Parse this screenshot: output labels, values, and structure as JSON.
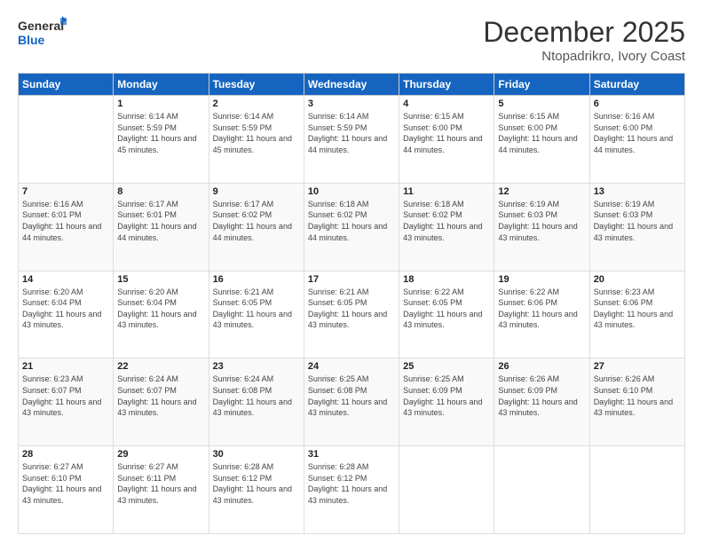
{
  "header": {
    "logo_line1": "General",
    "logo_line2": "Blue",
    "title": "December 2025",
    "subtitle": "Ntopadrikro, Ivory Coast"
  },
  "days_of_week": [
    "Sunday",
    "Monday",
    "Tuesday",
    "Wednesday",
    "Thursday",
    "Friday",
    "Saturday"
  ],
  "weeks": [
    [
      {
        "day": "",
        "info": ""
      },
      {
        "day": "1",
        "info": "Sunrise: 6:14 AM\nSunset: 5:59 PM\nDaylight: 11 hours and 45 minutes."
      },
      {
        "day": "2",
        "info": "Sunrise: 6:14 AM\nSunset: 5:59 PM\nDaylight: 11 hours and 45 minutes."
      },
      {
        "day": "3",
        "info": "Sunrise: 6:14 AM\nSunset: 5:59 PM\nDaylight: 11 hours and 44 minutes."
      },
      {
        "day": "4",
        "info": "Sunrise: 6:15 AM\nSunset: 6:00 PM\nDaylight: 11 hours and 44 minutes."
      },
      {
        "day": "5",
        "info": "Sunrise: 6:15 AM\nSunset: 6:00 PM\nDaylight: 11 hours and 44 minutes."
      },
      {
        "day": "6",
        "info": "Sunrise: 6:16 AM\nSunset: 6:00 PM\nDaylight: 11 hours and 44 minutes."
      }
    ],
    [
      {
        "day": "7",
        "info": "Sunrise: 6:16 AM\nSunset: 6:01 PM\nDaylight: 11 hours and 44 minutes."
      },
      {
        "day": "8",
        "info": "Sunrise: 6:17 AM\nSunset: 6:01 PM\nDaylight: 11 hours and 44 minutes."
      },
      {
        "day": "9",
        "info": "Sunrise: 6:17 AM\nSunset: 6:02 PM\nDaylight: 11 hours and 44 minutes."
      },
      {
        "day": "10",
        "info": "Sunrise: 6:18 AM\nSunset: 6:02 PM\nDaylight: 11 hours and 44 minutes."
      },
      {
        "day": "11",
        "info": "Sunrise: 6:18 AM\nSunset: 6:02 PM\nDaylight: 11 hours and 43 minutes."
      },
      {
        "day": "12",
        "info": "Sunrise: 6:19 AM\nSunset: 6:03 PM\nDaylight: 11 hours and 43 minutes."
      },
      {
        "day": "13",
        "info": "Sunrise: 6:19 AM\nSunset: 6:03 PM\nDaylight: 11 hours and 43 minutes."
      }
    ],
    [
      {
        "day": "14",
        "info": "Sunrise: 6:20 AM\nSunset: 6:04 PM\nDaylight: 11 hours and 43 minutes."
      },
      {
        "day": "15",
        "info": "Sunrise: 6:20 AM\nSunset: 6:04 PM\nDaylight: 11 hours and 43 minutes."
      },
      {
        "day": "16",
        "info": "Sunrise: 6:21 AM\nSunset: 6:05 PM\nDaylight: 11 hours and 43 minutes."
      },
      {
        "day": "17",
        "info": "Sunrise: 6:21 AM\nSunset: 6:05 PM\nDaylight: 11 hours and 43 minutes."
      },
      {
        "day": "18",
        "info": "Sunrise: 6:22 AM\nSunset: 6:05 PM\nDaylight: 11 hours and 43 minutes."
      },
      {
        "day": "19",
        "info": "Sunrise: 6:22 AM\nSunset: 6:06 PM\nDaylight: 11 hours and 43 minutes."
      },
      {
        "day": "20",
        "info": "Sunrise: 6:23 AM\nSunset: 6:06 PM\nDaylight: 11 hours and 43 minutes."
      }
    ],
    [
      {
        "day": "21",
        "info": "Sunrise: 6:23 AM\nSunset: 6:07 PM\nDaylight: 11 hours and 43 minutes."
      },
      {
        "day": "22",
        "info": "Sunrise: 6:24 AM\nSunset: 6:07 PM\nDaylight: 11 hours and 43 minutes."
      },
      {
        "day": "23",
        "info": "Sunrise: 6:24 AM\nSunset: 6:08 PM\nDaylight: 11 hours and 43 minutes."
      },
      {
        "day": "24",
        "info": "Sunrise: 6:25 AM\nSunset: 6:08 PM\nDaylight: 11 hours and 43 minutes."
      },
      {
        "day": "25",
        "info": "Sunrise: 6:25 AM\nSunset: 6:09 PM\nDaylight: 11 hours and 43 minutes."
      },
      {
        "day": "26",
        "info": "Sunrise: 6:26 AM\nSunset: 6:09 PM\nDaylight: 11 hours and 43 minutes."
      },
      {
        "day": "27",
        "info": "Sunrise: 6:26 AM\nSunset: 6:10 PM\nDaylight: 11 hours and 43 minutes."
      }
    ],
    [
      {
        "day": "28",
        "info": "Sunrise: 6:27 AM\nSunset: 6:10 PM\nDaylight: 11 hours and 43 minutes."
      },
      {
        "day": "29",
        "info": "Sunrise: 6:27 AM\nSunset: 6:11 PM\nDaylight: 11 hours and 43 minutes."
      },
      {
        "day": "30",
        "info": "Sunrise: 6:28 AM\nSunset: 6:12 PM\nDaylight: 11 hours and 43 minutes."
      },
      {
        "day": "31",
        "info": "Sunrise: 6:28 AM\nSunset: 6:12 PM\nDaylight: 11 hours and 43 minutes."
      },
      {
        "day": "",
        "info": ""
      },
      {
        "day": "",
        "info": ""
      },
      {
        "day": "",
        "info": ""
      }
    ]
  ]
}
